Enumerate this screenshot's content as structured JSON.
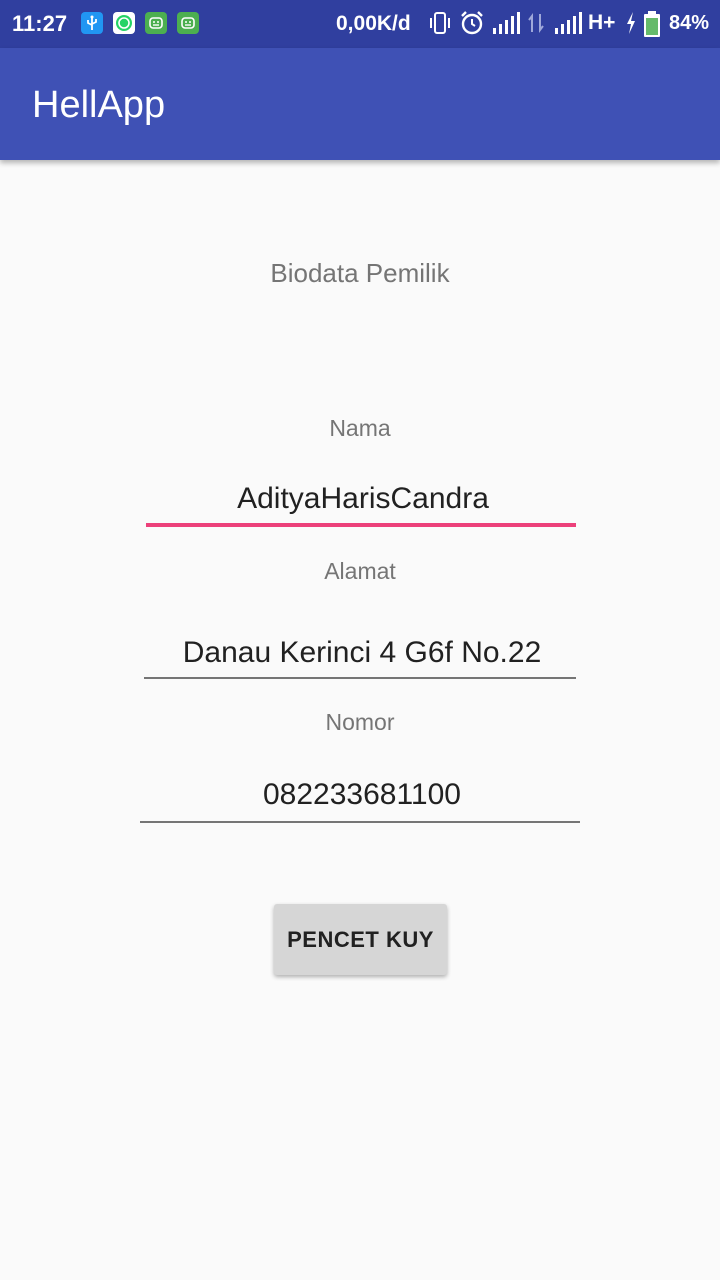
{
  "status_bar": {
    "time": "11:27",
    "speed": "0,00K/d",
    "network": "H+",
    "battery": "84%",
    "notification_icons": [
      "usb-icon",
      "whatsapp-icon",
      "android-icon",
      "android-icon"
    ]
  },
  "app_bar": {
    "title": "HellApp",
    "color": "#3F51B5"
  },
  "form": {
    "heading": "Biodata Pemilik",
    "name_label": "Nama",
    "name_value": "AdityaHarisCandra",
    "address_label": "Alamat",
    "address_value": "Danau Kerinci 4 G6f No.22",
    "phone_label": "Nomor",
    "phone_value": "082233681100",
    "submit_label": "PENCET KUY",
    "focus_color": "#EC407A"
  }
}
